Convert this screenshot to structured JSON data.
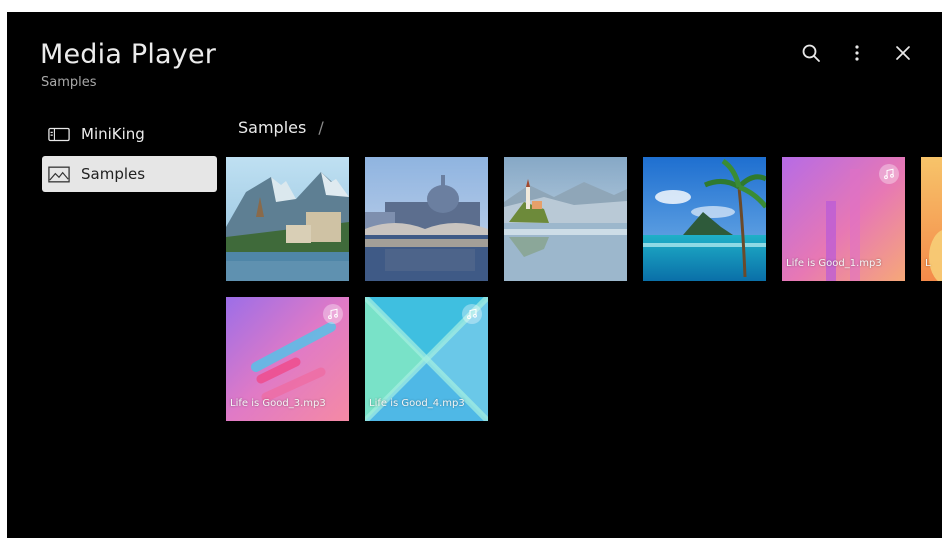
{
  "header": {
    "title": "Media Player",
    "subtitle": "Samples",
    "icons": [
      "search-icon",
      "more-vertical-icon",
      "close-icon"
    ]
  },
  "sidebar": {
    "items": [
      {
        "label": "MiniKing",
        "icon": "storage-device-icon",
        "active": false
      },
      {
        "label": "Samples",
        "icon": "image-icon",
        "active": true
      }
    ]
  },
  "breadcrumb": {
    "current": "Samples",
    "separator": "/"
  },
  "media": {
    "items": [
      {
        "type": "image",
        "label": "",
        "scene": "mountain-lake-village"
      },
      {
        "type": "image",
        "label": "",
        "scene": "cathedral-bridge-river"
      },
      {
        "type": "image",
        "label": "",
        "scene": "lake-island-church"
      },
      {
        "type": "image",
        "label": "",
        "scene": "tropical-palm-pool"
      },
      {
        "type": "audio",
        "label": "Life is Good_1.mp3",
        "icon": "music-note-icon"
      },
      {
        "type": "audio",
        "label": "Life is Good_3.mp3",
        "icon": "music-note-icon"
      },
      {
        "type": "audio",
        "label": "Life is Good_4.mp3",
        "icon": "music-note-icon"
      },
      {
        "type": "audio",
        "label": "L",
        "icon": "music-note-icon"
      }
    ]
  },
  "colors": {
    "background": "#000000",
    "sidebar_active": "#e6e6e6",
    "text_primary": "#ececec",
    "text_secondary": "#a9a9a9"
  }
}
